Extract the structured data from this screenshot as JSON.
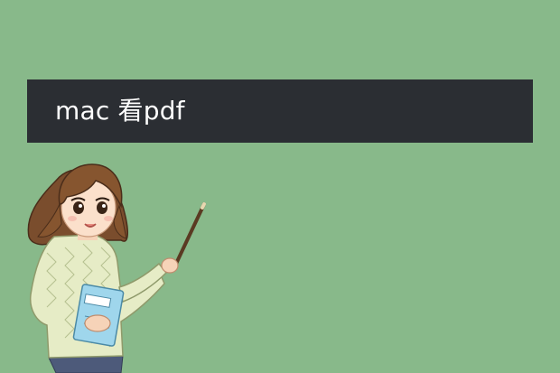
{
  "slide": {
    "title": "mac 看pdf"
  },
  "colors": {
    "background": "#88b98a",
    "banner": "#2b2e33",
    "title_text": "#ffffff"
  },
  "illustration": {
    "subject": "teacher-girl-with-pointer-and-book"
  }
}
